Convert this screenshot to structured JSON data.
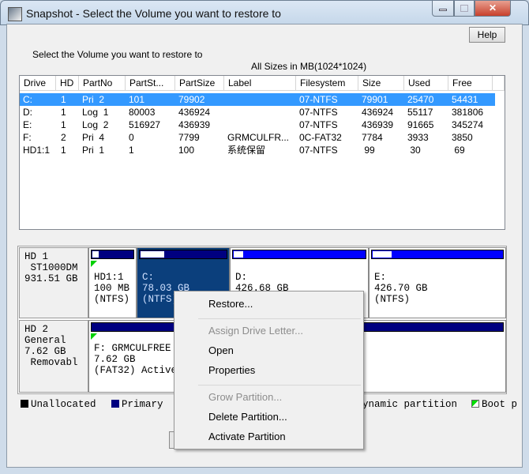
{
  "window": {
    "title": "Snapshot - Select the Volume you want to restore to",
    "help": "Help"
  },
  "instruction": "Select the Volume you want to restore to",
  "sizes_note": "All Sizes in MB(1024*1024)",
  "columns": [
    "Drive",
    "HD",
    "PartNo",
    "PartSt...",
    "PartSize",
    "Label",
    "Filesystem",
    "Size",
    "Used",
    "Free"
  ],
  "rows": [
    [
      "C:",
      "1",
      "Pri  2",
      "101",
      "79902",
      "",
      "07-NTFS",
      "79901",
      "25470",
      "54431"
    ],
    [
      "D:",
      "1",
      "Log  1",
      "80003",
      "436924",
      "",
      "07-NTFS",
      "436924",
      "55117",
      "381806"
    ],
    [
      "E:",
      "1",
      "Log  2",
      "516927",
      "436939",
      "",
      "07-NTFS",
      "436939",
      "91665",
      "345274"
    ],
    [
      "F:",
      "2",
      "Pri  4",
      "0",
      "7799",
      "GRMCULFR...",
      "0C-FAT32",
      "7784",
      "3933",
      "3850"
    ],
    [
      "HD1:1",
      "1",
      "Pri  1",
      "1",
      "100",
      "系统保留",
      "07-NTFS",
      " 99",
      " 30",
      " 69"
    ]
  ],
  "disks": [
    {
      "l1": "HD 1",
      "l2": " ST1000DM",
      "l3": "931.51 GB",
      "parts": [
        {
          "n": "HD1:1",
          "s": "100 MB",
          "f": "(NTFS)"
        },
        {
          "n": "C:",
          "s": "78.03 GB",
          "f": "(NTFS)"
        },
        {
          "n": "D:",
          "s": "426.68 GB",
          "f": ""
        },
        {
          "n": "E:",
          "s": "426.70 GB",
          "f": "(NTFS)"
        }
      ]
    },
    {
      "l1": "HD 2",
      "l2": "General",
      "l3": "7.62 GB",
      "l4": " Removabl",
      "parts": [
        {
          "n": "F: GRMCULFREE",
          "s": "7.62 GB",
          "f": "(FAT32) Active"
        }
      ]
    }
  ],
  "legend": [
    "Unallocated",
    "Primary",
    "ynamic partition",
    "Boot p"
  ],
  "menu": [
    "Restore...",
    "Assign Drive Letter...",
    "Open",
    "Properties",
    "Grow Partition...",
    "Delete Partition...",
    "Activate Partition"
  ],
  "colors": {
    "primary": "#000080",
    "logical": "#0000ff",
    "selected": "#3399ff",
    "boot": "#00d000"
  }
}
